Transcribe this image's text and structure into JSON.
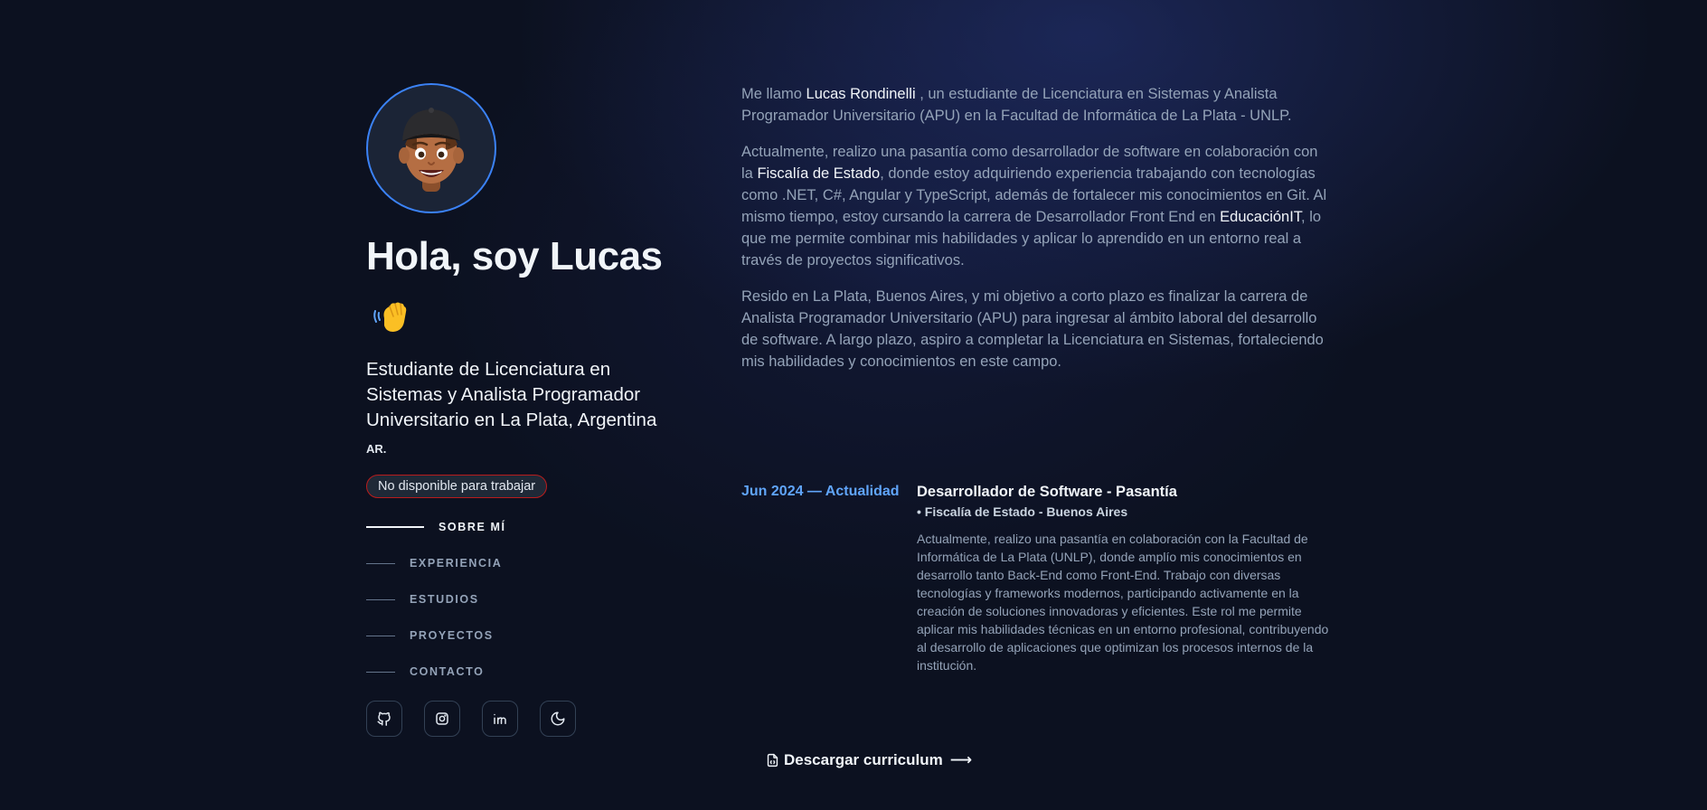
{
  "profile": {
    "greeting": "Hola, soy Lucas",
    "subtitle": "Estudiante de Licenciatura en Sistemas y Analista Programador Universitario en La Plata, Argentina",
    "subtitle_tail": "AR.",
    "status": "No disponible para trabajar",
    "status_color": "#b91c1c",
    "accent_color": "#3b82f6"
  },
  "nav": {
    "items": [
      {
        "label": "SOBRE MÍ",
        "active": true
      },
      {
        "label": "EXPERIENCIA",
        "active": false
      },
      {
        "label": "ESTUDIOS",
        "active": false
      },
      {
        "label": "PROYECTOS",
        "active": false
      },
      {
        "label": "CONTACTO",
        "active": false
      }
    ]
  },
  "socials": {
    "items": [
      {
        "icon": "github-icon"
      },
      {
        "icon": "instagram-icon"
      },
      {
        "icon": "linkedin-icon"
      },
      {
        "icon": "moon-icon"
      }
    ]
  },
  "about": {
    "p1_a": "Me llamo ",
    "p1_name": "Lucas Rondinelli",
    "p1_b": " , un estudiante de Licenciatura en Sistemas y Analista Programador Universitario (APU) en la Facultad de Informática de La Plata - UNLP.",
    "p2_a": "Actualmente, realizo una pasantía como desarrollador de software en colaboración con la ",
    "p2_hl1": "Fiscalía de Estado",
    "p2_b": ", donde estoy adquiriendo experiencia trabajando con tecnologías como .NET, C#, Angular y TypeScript, además de fortalecer mis conocimientos en Git. Al mismo tiempo, estoy cursando la carrera de Desarrollador Front End en ",
    "p2_hl2": "EducaciónIT",
    "p2_c": ", lo que me permite combinar mis habilidades y aplicar lo aprendido en un entorno real a través de proyectos significativos.",
    "p3": "Resido en La Plata, Buenos Aires, y mi objetivo a corto plazo es finalizar la carrera de Analista Programador Universitario (APU) para ingresar al ámbito laboral del desarrollo de software. A largo plazo, aspiro a completar la Licenciatura en Sistemas, fortaleciendo mis habilidades y conocimientos en este campo."
  },
  "experience": {
    "date": "Jun 2024 — Actualidad",
    "title": "Desarrollador de Software - Pasantía",
    "company": "• Fiscalía de Estado - Buenos Aires",
    "description": "Actualmente, realizo una pasantía en colaboración con la Facultad de Informática de La Plata (UNLP), donde amplío mis conocimientos en desarrollo tanto Back-End como Front-End. Trabajo con diversas tecnologías y frameworks modernos, participando activamente en la creación de soluciones innovadoras y eficientes. Este rol me permite aplicar mis habilidades técnicas en un entorno profesional, contribuyendo al desarrollo de aplicaciones que optimizan los procesos internos de la institución."
  },
  "cv": {
    "label": "Descargar curriculum",
    "arrow": "⟶"
  }
}
